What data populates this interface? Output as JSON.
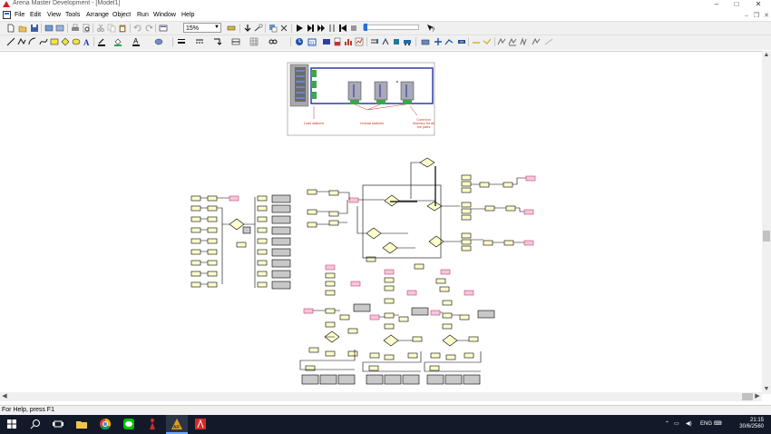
{
  "window": {
    "title": "Arena Master Development - [Model1]",
    "controls": [
      "–",
      "□",
      "✕"
    ]
  },
  "menu": {
    "items": [
      "File",
      "Edit",
      "View",
      "Tools",
      "Arrange",
      "Object",
      "Run",
      "Window",
      "Help"
    ]
  },
  "toolbar": {
    "zoom_value": "15%"
  },
  "diagram": {
    "label_load": "Load stations",
    "label_unload": "Unload stations",
    "label_common": "Common itinerary for all the parts"
  },
  "status": {
    "help_text": "For Help, press F1"
  },
  "taskbar": {
    "language": "ENG",
    "time": "21:15",
    "date": "30/6/2560"
  },
  "colors": {
    "accent": "#2a6fd6",
    "taskbar": "#121a2a",
    "module_fill": "#ffffcc",
    "annotation_red": "#c0392b",
    "frame_blue": "#1f2f9a"
  }
}
